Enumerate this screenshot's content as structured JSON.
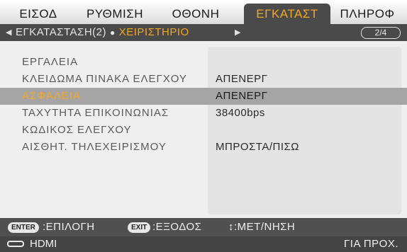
{
  "tabs": [
    {
      "label": "ΕΙΣΟΔ"
    },
    {
      "label": "ΡΥΘΜΙΣΗ"
    },
    {
      "label": "ΟΘΟΝΗ"
    },
    {
      "label": "ΕΓΚΑΤΑΣΤ"
    },
    {
      "label": "ΠΛΗΡΟΦ"
    }
  ],
  "active_tab": "ΕΓΚΑΤΑΣΤ",
  "subbar": {
    "prev_section": "ΕΓΚΑΤΑΣΤΑΣΗ(2)",
    "current_section": "ΧΕΙΡΙΣΤΗΡΙΟ",
    "page_indicator": "2/4"
  },
  "menu": {
    "rows": [
      {
        "label": "ΕΡΓΑΛΕΙΑ",
        "value": ""
      },
      {
        "label": "ΚΛΕΙΔΩΜΑ ΠΙΝΑΚΑ ΕΛΕΓΧΟΥ",
        "value": "ΑΠΕΝΕΡΓ"
      },
      {
        "label": "ΑΣΦΑΛΕΙΑ",
        "value": "ΑΠΕΝΕΡΓ"
      },
      {
        "label": "ΤΑΧΥΤΗΤΑ ΕΠΙΚΟΙΝΩΝΙΑΣ",
        "value": "38400bps"
      },
      {
        "label": "ΚΩΔΙΚΟΣ ΕΛΕΓΧΟΥ",
        "value": ""
      },
      {
        "label": "ΑΙΣΘΗΤ. ΤΗΛΕΧΕΙΡΙΣΜΟΥ",
        "value": "ΜΠΡΟΣΤΑ/ΠΙΣΩ"
      }
    ],
    "selected_row": "ΑΣΦΑΛΕΙΑ"
  },
  "footer": {
    "enter_key": "ENTER",
    "enter_action": ":ΕΠΙΛΟΓΗ",
    "exit_key": "EXIT",
    "exit_action": ":ΕΞΟΔΟΣ",
    "move_action": "↕:ΜΕΤ/ΝΗΣΗ",
    "source": "HDMI",
    "info": "ΓΙΑ ΠΡΟΧ."
  },
  "colors": {
    "accent": "#f5a623",
    "header_dark": "#4a4a4a",
    "selected_row": "#a5a5a5"
  }
}
